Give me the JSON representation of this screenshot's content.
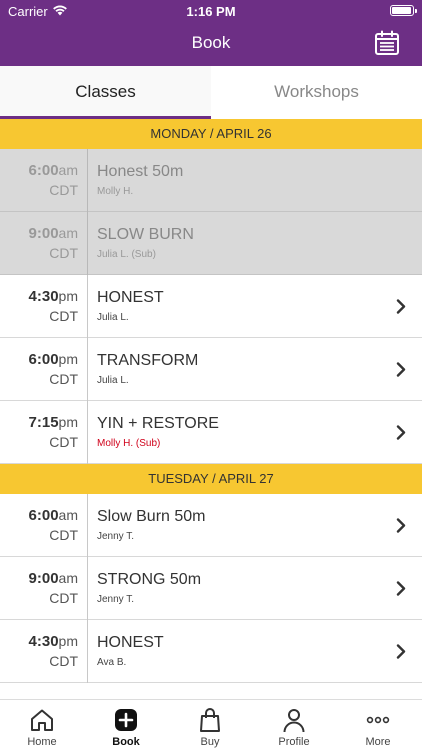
{
  "status_bar": {
    "carrier": "Carrier",
    "time": "1:16 PM"
  },
  "nav": {
    "title": "Book"
  },
  "tabs": [
    {
      "label": "Classes",
      "active": true
    },
    {
      "label": "Workshops",
      "active": false
    }
  ],
  "days": [
    {
      "header": "MONDAY / APRIL 26",
      "classes": [
        {
          "time": "6:00",
          "ampm": "am",
          "tz": "CDT",
          "name": "Honest 50m",
          "instructor": "Molly H.",
          "past": true,
          "sub": false
        },
        {
          "time": "9:00",
          "ampm": "am",
          "tz": "CDT",
          "name": "SLOW BURN",
          "instructor": "Julia L. (Sub)",
          "past": true,
          "sub": false
        },
        {
          "time": "4:30",
          "ampm": "pm",
          "tz": "CDT",
          "name": "HONEST",
          "instructor": "Julia L.",
          "past": false,
          "sub": false
        },
        {
          "time": "6:00",
          "ampm": "pm",
          "tz": "CDT",
          "name": "TRANSFORM",
          "instructor": "Julia L.",
          "past": false,
          "sub": false
        },
        {
          "time": "7:15",
          "ampm": "pm",
          "tz": "CDT",
          "name": "YIN + RESTORE",
          "instructor": "Molly H. (Sub)",
          "past": false,
          "sub": true
        }
      ]
    },
    {
      "header": "TUESDAY / APRIL 27",
      "classes": [
        {
          "time": "6:00",
          "ampm": "am",
          "tz": "CDT",
          "name": "Slow Burn 50m",
          "instructor": "Jenny T.",
          "past": false,
          "sub": false
        },
        {
          "time": "9:00",
          "ampm": "am",
          "tz": "CDT",
          "name": "STRONG 50m",
          "instructor": "Jenny T.",
          "past": false,
          "sub": false
        },
        {
          "time": "4:30",
          "ampm": "pm",
          "tz": "CDT",
          "name": "HONEST",
          "instructor": "Ava B.",
          "past": false,
          "sub": false
        }
      ]
    }
  ],
  "tabbar": [
    {
      "label": "Home",
      "icon": "home-icon",
      "active": false
    },
    {
      "label": "Book",
      "icon": "plus-square-icon",
      "active": true
    },
    {
      "label": "Buy",
      "icon": "shopping-bag-icon",
      "active": false
    },
    {
      "label": "Profile",
      "icon": "person-icon",
      "active": false
    },
    {
      "label": "More",
      "icon": "more-dots-icon",
      "active": false
    }
  ],
  "colors": {
    "brand": "#6d2f85",
    "day_header": "#f7c731",
    "sub_text": "#d0021b",
    "past_row": "#d9d9d9"
  }
}
